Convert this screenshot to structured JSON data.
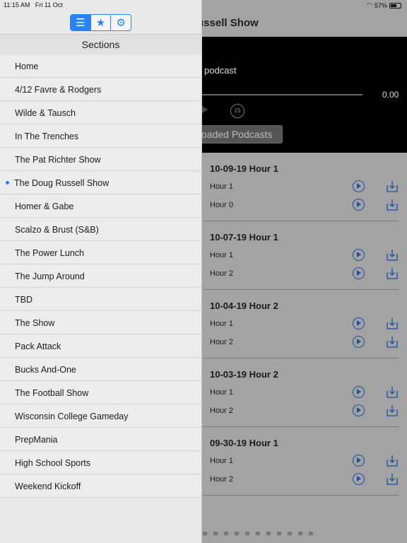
{
  "status": {
    "time": "11:15 AM",
    "date": "Fri 11 Oct",
    "battery": "57%"
  },
  "main": {
    "nav_title": "ussell Show",
    "player": {
      "podcast_title": "podcast",
      "time": "0.00",
      "skip_seconds": "15",
      "downloaded_label": "oaded Podcasts"
    },
    "episodes": [
      {
        "title": "10-09-19 Hour 1",
        "hours": [
          "Hour 1",
          "Hour 0"
        ]
      },
      {
        "title": "10-07-19 Hour 1",
        "hours": [
          "Hour 1",
          "Hour 2"
        ]
      },
      {
        "title": "10-04-19 Hour 2",
        "hours": [
          "Hour 1",
          "Hour 2"
        ]
      },
      {
        "title": "10-03-19 Hour 2",
        "hours": [
          "Hour 1",
          "Hour 2"
        ]
      },
      {
        "title": "09-30-19 Hour 1",
        "hours": [
          "Hour 1",
          "Hour 2"
        ]
      }
    ]
  },
  "sidebar": {
    "segments": [
      {
        "icon": "list-icon",
        "glyph": "☰",
        "active": true
      },
      {
        "icon": "star-icon",
        "glyph": "★",
        "active": false
      },
      {
        "icon": "gear-icon",
        "glyph": "⚙",
        "active": false
      }
    ],
    "header": "Sections",
    "current_index": 5,
    "items": [
      "Home",
      "4/12 Favre & Rodgers",
      "Wilde & Tausch",
      "In The Trenches",
      "The Pat Richter Show",
      "The Doug Russell Show",
      "Homer & Gabe",
      "Scalzo & Brust (S&B)",
      "The Power Lunch",
      "The Jump Around",
      "TBD",
      "The Show",
      "Pack Attack",
      "Bucks And-One",
      "The Football Show",
      "Wisconsin College Gameday",
      "PrepMania",
      "High School Sports",
      "Weekend Kickoff"
    ]
  },
  "colors": {
    "accent": "#2a82f7",
    "icon_blue": "#1e4fa0"
  }
}
